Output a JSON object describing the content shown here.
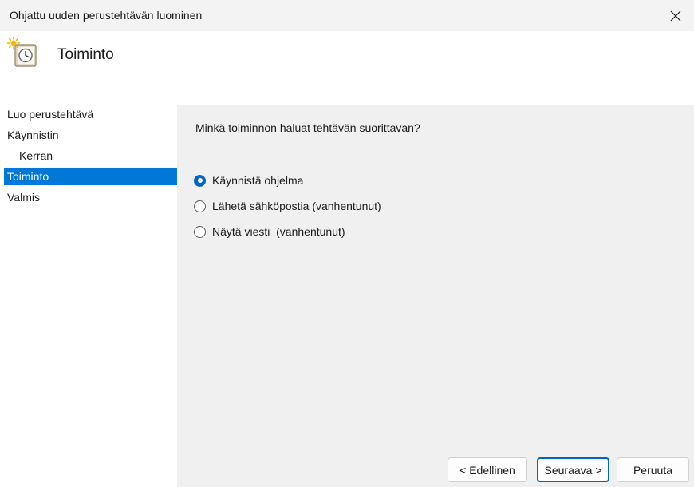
{
  "window": {
    "title": "Ohjattu uuden perustehtävän luominen"
  },
  "header": {
    "title": "Toiminto",
    "icon": "task-scheduler-clock-icon"
  },
  "sidebar": {
    "items": [
      {
        "label": "Luo perustehtävä",
        "selected": false,
        "indent": false
      },
      {
        "label": "Käynnistin",
        "selected": false,
        "indent": false
      },
      {
        "label": "Kerran",
        "selected": false,
        "indent": true
      },
      {
        "label": "Toiminto",
        "selected": true,
        "indent": false
      },
      {
        "label": "Valmis",
        "selected": false,
        "indent": false
      }
    ]
  },
  "main": {
    "question": "Minkä toiminnon haluat tehtävän suorittavan?",
    "options": [
      {
        "label": "Käynnistä ohjelma",
        "checked": true
      },
      {
        "label": "Lähetä sähköpostia (vanhentunut)",
        "checked": false
      },
      {
        "label": "Näytä viesti  (vanhentunut)",
        "checked": false
      }
    ]
  },
  "buttons": {
    "back": "< Edellinen",
    "next": "Seuraava >",
    "cancel": "Peruuta"
  },
  "colors": {
    "accent": "#0067c0",
    "selection": "#0078d7"
  }
}
